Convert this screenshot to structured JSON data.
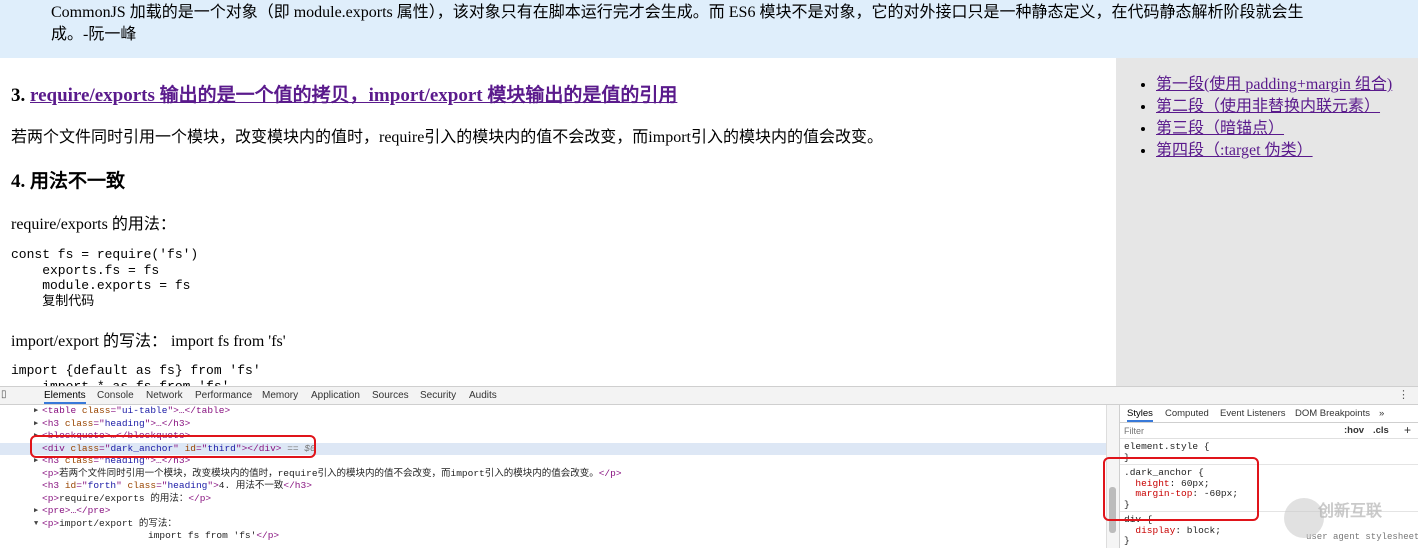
{
  "page": {
    "quote_text": "CommonJS 加载的是一个对象（即 module.exports 属性），该对象只有在脚本运行完才会生成。而 ES6 模块不是对象，它的对外接口只是一种静态定义，在代码静态解析阶段就会生成。-阮一峰",
    "section3_num": "3. ",
    "section3_title": "require/exports 输出的是一个值的拷贝，import/export 模块输出的是值的引用",
    "para1": "若两个文件同时引用一个模块，改变模块内的值时，require引入的模块内的值不会改变，而import引入的模块内的值会改变。",
    "section4_title": "4. 用法不一致",
    "para2": "require/exports 的用法：",
    "code1": "const fs = require('fs')\n    exports.fs = fs\n    module.exports = fs\n    复制代码",
    "para3": "import/export 的写法： import fs from 'fs'",
    "code2": "import {default as fs} from 'fs'\n    import * as fs from 'fs'",
    "toc": [
      "第一段(使用 padding+margin 组合)",
      "第二段（使用非替换内联元素）",
      "第三段（暗锚点）",
      "第四段（:target 伪类）"
    ]
  },
  "devtools": {
    "tabs": [
      "Elements",
      "Console",
      "Network",
      "Performance",
      "Memory",
      "Application",
      "Sources",
      "Security",
      "Audits"
    ],
    "active_tab": "Elements",
    "elements": {
      "r1": {
        "a": "<table ",
        "b": "class",
        "c": "=\"",
        "d": "ui-table",
        "e": "\">…</table>"
      },
      "r2": {
        "a": "<h3 ",
        "b": "class",
        "c": "=\"",
        "d": "heading",
        "e": "\">…</h3>"
      },
      "r3": {
        "a": "<blockquote>…</blockquote>"
      },
      "r4": {
        "a": "<div ",
        "b": "class",
        "c": "=\"",
        "d": "dark_anchor",
        "e": "\" ",
        "f": "id",
        "g": "=\"",
        "h": "third",
        "i": "\"></div>",
        "j": " == $0"
      },
      "r5": {
        "a": "<h3 ",
        "b": "class",
        "c": "=\"",
        "d": "heading",
        "e": "\">…</h3>"
      },
      "r6": {
        "a": "<p>",
        "t": "若两个文件同时引用一个模块，改变模块内的值时，require引入的模块内的值不会改变，而import引入的模块内的值会改变。",
        "z": "</p>"
      },
      "r7": {
        "a": "<h3 ",
        "b": "id",
        "c": "=\"",
        "d": "forth",
        "e": "\" ",
        "f": "class",
        "g": "=\"",
        "h": "heading",
        "i": "\">",
        "t": "4. 用法不一致",
        "z": "</h3>"
      },
      "r8": {
        "a": "<p>",
        "t": "require/exports 的用法：",
        "z": "</p>"
      },
      "r9": {
        "a": "<pre>…</pre>"
      },
      "r10": {
        "a": "<p>",
        "t": "import/export 的写法："
      },
      "r11": {
        "t": "import fs from 'fs'",
        "z": "</p>"
      }
    },
    "styles": {
      "tabs": [
        "Styles",
        "Computed",
        "Event Listeners",
        "DOM Breakpoints",
        "»"
      ],
      "active_tab": "Styles",
      "filter_placeholder": "Filter",
      "hov": ":hov",
      "cls": ".cls",
      "plus": "+",
      "element_style": "element.style {",
      "close": "}",
      "dark_anchor_selector": ".dark_anchor {",
      "height_prop": "height",
      "height_val": ": 60px;",
      "margin_prop": "margin-top",
      "margin_val": ": -60px;",
      "div_selector": "div {",
      "display_prop": "display",
      "display_val": ": block;",
      "user_agent": "user agent stylesheet"
    }
  },
  "watermark": "创新互联"
}
